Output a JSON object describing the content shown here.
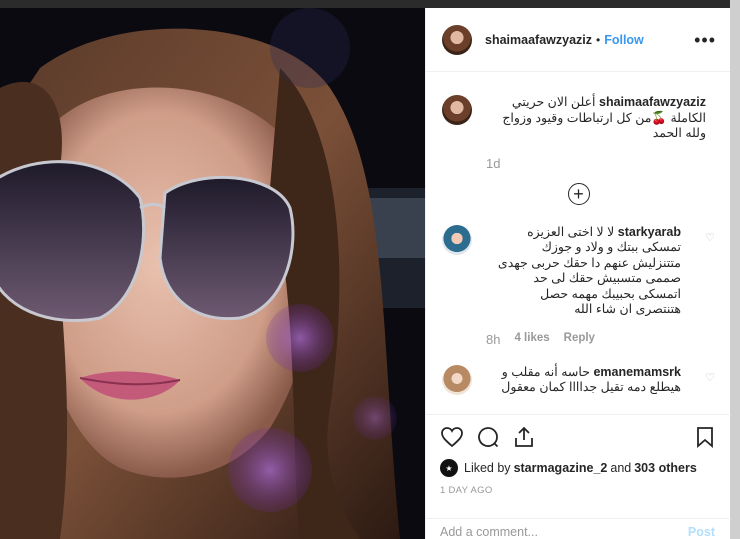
{
  "header": {
    "username": "shaimaafawzyaziz",
    "dot": "•",
    "follow_label": "Follow",
    "more_icon": "more-options-icon"
  },
  "caption": {
    "username": "shaimaafawzyaziz",
    "text_line1": "أعلن الان حريتي",
    "text_line2": "الكاملة 🍒من كل ارتباطات وقيود وزواج",
    "text_line3": "ولله الحمد",
    "time": "1d"
  },
  "load_more_label": "+",
  "comments": [
    {
      "username": "starkyarab",
      "lines": [
        "لا لا اختى العزيزه",
        "تمسكى ببتك و ولاد و جوزك",
        "متتنزليش عنهم دا حقك حربى جهدى",
        "صممى متسبيش حقك لى حد",
        "اتمسكى بحبيبك مهمه حصل",
        "هتنتصرى ان شاء الله"
      ],
      "time": "8h",
      "likes": "4 likes",
      "reply": "Reply"
    },
    {
      "username": "emanemamsrk",
      "lines": [
        "حاسه أنه مقلب و",
        "هيطلع دمه تقيل جداااا كمان معقول"
      ],
      "time": "",
      "likes": "",
      "reply": ""
    }
  ],
  "likes": {
    "prefix": "Liked by",
    "user": "starmagazine_2",
    "and": "and",
    "others": "303 others"
  },
  "timestamp": "1 DAY AGO",
  "add_comment": {
    "placeholder": "Add a comment...",
    "post_label": "Post"
  },
  "colors": {
    "follow": "#3897f0",
    "post_disabled": "#b2dffc",
    "meta": "#999999"
  }
}
